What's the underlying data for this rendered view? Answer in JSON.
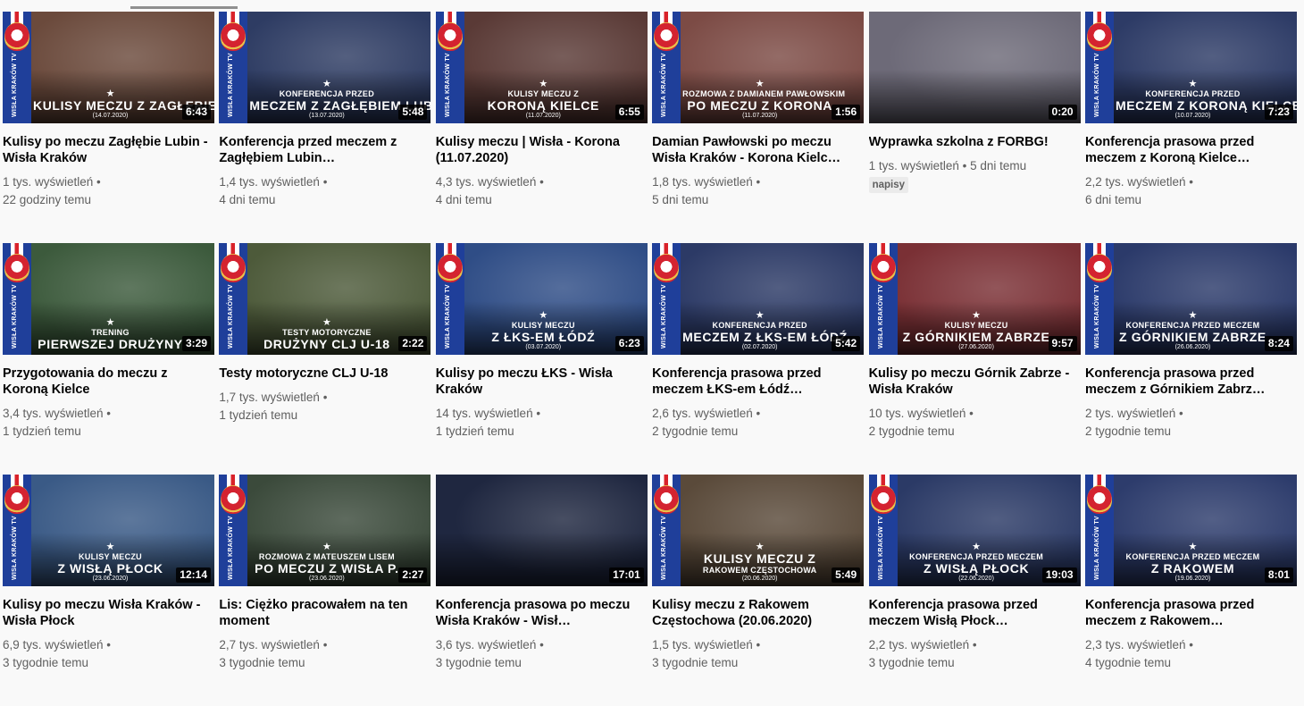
{
  "channel": {
    "badge_text": "WISŁA KRAKÓW TV"
  },
  "videos": [
    {
      "title": "Kulisy po meczu Zagłębie Lubin - Wisła Kraków",
      "views": "1 tys. wyświetleń",
      "age": "22 godziny temu",
      "duration": "6:43",
      "ov_small": "",
      "ov_big": "KULISY MECZU Z ZAGŁĘBIEM LUBIN",
      "ov_date": "(14.07.2020)",
      "bg": "#6b4a3c"
    },
    {
      "title": "Konferencja przed meczem z Zagłębiem Lubin…",
      "views": "1,4 tys. wyświetleń",
      "age": "4 dni temu",
      "duration": "5:48",
      "ov_small": "KONFERENCJA PRZED",
      "ov_big": "MECZEM Z ZAGŁĘBIEM LUBIN",
      "ov_date": "(13.07.2020)",
      "bg": "#2e3c63"
    },
    {
      "title": "Kulisy meczu | Wisła - Korona (11.07.2020)",
      "views": "4,3 tys. wyświetleń",
      "age": "4 dni temu",
      "duration": "6:55",
      "ov_small": "KULISY MECZU Z",
      "ov_big": "KORONĄ KIELCE",
      "ov_date": "(11.07.2020)",
      "bg": "#5a3a36"
    },
    {
      "title": "Damian Pawłowski po meczu Wisła Kraków - Korona Kielc…",
      "views": "1,8 tys. wyświetleń",
      "age": "5 dni temu",
      "duration": "1:56",
      "ov_small": "ROZMOWA Z DAMIANEM PAWŁOWSKIM",
      "ov_big": "PO MECZU Z KORONA",
      "ov_date": "(11.07.2020)",
      "bg": "#7c4b45"
    },
    {
      "title": "Wyprawka szkolna z FORBG!",
      "views": "1 tys. wyświetleń",
      "age": "5 dni temu",
      "badge": "napisy",
      "duration": "0:20",
      "ov_small": "",
      "ov_big": "",
      "ov_date": "",
      "bg": "#6d6a78"
    },
    {
      "title": "Konferencja prasowa przed meczem z Koroną Kielce…",
      "views": "2,2 tys. wyświetleń",
      "age": "6 dni temu",
      "duration": "7:23",
      "ov_small": "KONFERENCJA PRZED",
      "ov_big": "MECZEM Z KORONĄ KIELCE",
      "ov_date": "(10.07.2020)",
      "bg": "#2d3b66"
    },
    {
      "title": "Przygotowania do meczu z Koroną Kielce",
      "views": "3,4 tys. wyświetleń",
      "age": "1 tydzień temu",
      "duration": "3:29",
      "ov_small": "TRENING",
      "ov_big": "PIERWSZEJ DRUŻYNY",
      "ov_date": "",
      "bg": "#3c5a3c"
    },
    {
      "title": "Testy motoryczne CLJ U-18",
      "views": "1,7 tys. wyświetleń",
      "age": "1 tydzień temu",
      "duration": "2:22",
      "ov_small": "TESTY MOTORYCZNE",
      "ov_big": "DRUŻYNY CLJ U-18",
      "ov_date": "",
      "bg": "#4d5a3a"
    },
    {
      "title": "Kulisy po meczu ŁKS - Wisła Kraków",
      "views": "14 tys. wyświetleń",
      "age": "1 tydzień temu",
      "duration": "6:23",
      "ov_small": "KULISY MECZU",
      "ov_big": "Z ŁKS-EM ŁÓDŹ",
      "ov_date": "(03.07.2020)",
      "bg": "#2f4d86"
    },
    {
      "title": "Konferencja prasowa przed meczem ŁKS-em Łódź…",
      "views": "2,6 tys. wyświetleń",
      "age": "2 tygodnie temu",
      "duration": "5:42",
      "ov_small": "KONFERENCJA PRZED",
      "ov_big": "MECZEM Z ŁKS-EM ŁÓDŹ",
      "ov_date": "(02.07.2020)",
      "bg": "#2c3a66"
    },
    {
      "title": "Kulisy po meczu Górnik Zabrze - Wisła Kraków",
      "views": "10 tys. wyświetleń",
      "age": "2 tygodnie temu",
      "duration": "9:57",
      "ov_small": "KULISY MECZU",
      "ov_big": "Z GÓRNIKIEM ZABRZE",
      "ov_date": "(27.06.2020)",
      "bg": "#7a3035"
    },
    {
      "title": "Konferencja prasowa przed meczem z Górnikiem Zabrz…",
      "views": "2 tys. wyświetleń",
      "age": "2 tygodnie temu",
      "duration": "8:24",
      "ov_small": "KONFERENCJA PRZED MECZEM",
      "ov_big": "Z GÓRNIKIEM ZABRZE",
      "ov_date": "(26.06.2020)",
      "bg": "#2b3a6a"
    },
    {
      "title": "Kulisy po meczu Wisła Kraków - Wisła Płock",
      "views": "6,9 tys. wyświetleń",
      "age": "3 tygodnie temu",
      "duration": "12:14",
      "ov_small": "KULISY MECZU",
      "ov_big": "Z WISŁĄ PŁOCK",
      "ov_date": "(23.06.2020)",
      "bg": "#3a5a86"
    },
    {
      "title": "Lis: Ciężko pracowałem na ten moment",
      "views": "2,7 tys. wyświetleń",
      "age": "3 tygodnie temu",
      "duration": "2:27",
      "ov_small": "ROZMOWA Z MATEUSZEM LISEM",
      "ov_big": "PO MECZU Z WISŁA P.",
      "ov_date": "(23.06.2020)",
      "bg": "#3b4a3b"
    },
    {
      "title": "Konferencja prasowa po meczu Wisła Kraków - Wisł…",
      "views": "3,6 tys. wyświetleń",
      "age": "3 tygodnie temu",
      "duration": "17:01",
      "ov_small": "",
      "ov_big": "",
      "ov_date": "",
      "bg": "#1f2740"
    },
    {
      "title": "Kulisy meczu z Rakowem Częstochowa (20.06.2020)",
      "views": "1,5 tys. wyświetleń",
      "age": "3 tygodnie temu",
      "duration": "5:49",
      "ov_small": "",
      "ov_big": "KULISY MECZU Z",
      "ov_big2": "RAKOWEM CZĘSTOCHOWA",
      "ov_date": "(20.06.2020)",
      "bg": "#5a4a3a"
    },
    {
      "title": "Konferencja prasowa przed meczem Wisłą Płock…",
      "views": "2,2 tys. wyświetleń",
      "age": "3 tygodnie temu",
      "duration": "19:03",
      "ov_small": "KONFERENCJA PRZED MECZEM",
      "ov_big": "Z WISŁĄ PŁOCK",
      "ov_date": "(22.06.2020)",
      "bg": "#2b3a66"
    },
    {
      "title": "Konferencja prasowa przed meczem z Rakowem…",
      "views": "2,3 tys. wyświetleń",
      "age": "4 tygodnie temu",
      "duration": "8:01",
      "ov_small": "KONFERENCJA PRZED MECZEM",
      "ov_big": "Z RAKOWEM",
      "ov_date": "(19.06.2020)",
      "bg": "#2d3c6c"
    }
  ]
}
